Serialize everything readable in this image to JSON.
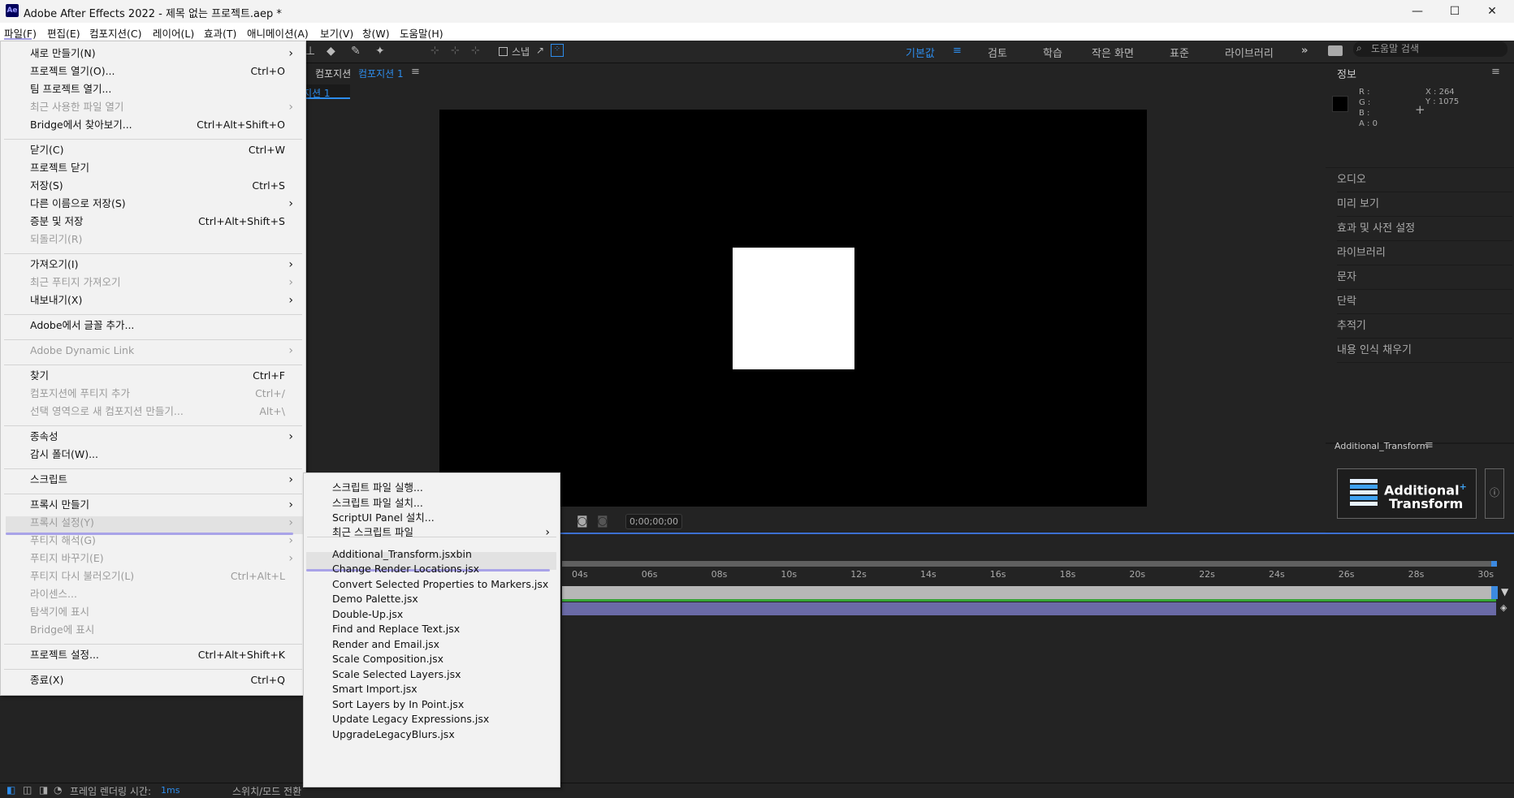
{
  "window": {
    "title": "Adobe After Effects 2022 - 제목 없는 프로젝트.aep *",
    "logo": "Ae",
    "minimize": "—",
    "maximize": "☐",
    "close": "✕"
  },
  "menubar": [
    "파일(F)",
    "편집(E)",
    "컴포지션(C)",
    "레이어(L)",
    "효과(T)",
    "애니메이션(A)",
    "보기(V)",
    "창(W)",
    "도움말(H)"
  ],
  "toolbar": {
    "snap_label": "스냅",
    "workspaces": [
      "기본값",
      "검토",
      "학습",
      "작은 화면",
      "표준",
      "라이브러리"
    ],
    "search_placeholder": "도움말 검색"
  },
  "composition": {
    "tab_prefix": "컴포지션",
    "tab_name": "컴포지션 1",
    "sub_tab": "지션 1",
    "timecode": "0;00;00;00",
    "accent": "#2d8ceb"
  },
  "info_panel": {
    "title": "정보",
    "r": "R :",
    "g": "G :",
    "b": "B :",
    "a": "A :  0",
    "x": "X : 264",
    "y": "Y : 1075"
  },
  "right_panels": [
    "오디오",
    "미리 보기",
    "효과 및 사전 설정",
    "라이브러리",
    "문자",
    "단락",
    "추적기",
    "내용 인식 채우기"
  ],
  "additional_transform": {
    "panel_title": "Additional_Transform",
    "line1": "Additional",
    "line2": "Transform",
    "plus": "+"
  },
  "timeline": {
    "ticks": [
      "04s",
      "06s",
      "08s",
      "10s",
      "12s",
      "14s",
      "16s",
      "18s",
      "20s",
      "22s",
      "24s",
      "26s",
      "28s",
      "30s"
    ]
  },
  "statusbar": {
    "render_label": "프레임 렌더링 시간:",
    "render_value": "1ms",
    "switch_label": "스위치/모드 전환"
  },
  "file_menu": [
    {
      "label": "새로 만들기(N)",
      "shortcut": "",
      "submenu": true,
      "disabled": false
    },
    {
      "label": "프로젝트 열기(O)...",
      "shortcut": "Ctrl+O",
      "submenu": false,
      "disabled": false
    },
    {
      "label": "팀 프로젝트 열기...",
      "shortcut": "",
      "submenu": false,
      "disabled": false
    },
    {
      "label": "최근 사용한 파일 열기",
      "shortcut": "",
      "submenu": true,
      "disabled": true
    },
    {
      "label": "Bridge에서 찾아보기...",
      "shortcut": "Ctrl+Alt+Shift+O",
      "submenu": false,
      "disabled": false
    },
    {
      "label": "닫기(C)",
      "shortcut": "Ctrl+W",
      "submenu": false,
      "disabled": false
    },
    {
      "label": "프로젝트 닫기",
      "shortcut": "",
      "submenu": false,
      "disabled": false
    },
    {
      "label": "저장(S)",
      "shortcut": "Ctrl+S",
      "submenu": false,
      "disabled": false
    },
    {
      "label": "다른 이름으로 저장(S)",
      "shortcut": "",
      "submenu": true,
      "disabled": false
    },
    {
      "label": "증분 및 저장",
      "shortcut": "Ctrl+Alt+Shift+S",
      "submenu": false,
      "disabled": false
    },
    {
      "label": "되돌리기(R)",
      "shortcut": "",
      "submenu": false,
      "disabled": true
    },
    {
      "label": "가져오기(I)",
      "shortcut": "",
      "submenu": true,
      "disabled": false
    },
    {
      "label": "최근 푸티지 가져오기",
      "shortcut": "",
      "submenu": true,
      "disabled": true
    },
    {
      "label": "내보내기(X)",
      "shortcut": "",
      "submenu": true,
      "disabled": false
    },
    {
      "label": "Adobe에서 글꼴 추가...",
      "shortcut": "",
      "submenu": false,
      "disabled": false
    },
    {
      "label": "Adobe Dynamic Link",
      "shortcut": "",
      "submenu": true,
      "disabled": true
    },
    {
      "label": "찾기",
      "shortcut": "Ctrl+F",
      "submenu": false,
      "disabled": false
    },
    {
      "label": "컴포지션에 푸티지 추가",
      "shortcut": "Ctrl+/",
      "submenu": false,
      "disabled": true
    },
    {
      "label": "선택 영역으로 새 컴포지션 만들기...",
      "shortcut": "Alt+\\",
      "submenu": false,
      "disabled": true
    },
    {
      "label": "종속성",
      "shortcut": "",
      "submenu": true,
      "disabled": false
    },
    {
      "label": "감시 폴더(W)...",
      "shortcut": "",
      "submenu": false,
      "disabled": false
    },
    {
      "label": "스크립트",
      "shortcut": "",
      "submenu": true,
      "disabled": false
    },
    {
      "label": "프록시 만들기",
      "shortcut": "",
      "submenu": true,
      "disabled": false
    },
    {
      "label": "프록시 설정(Y)",
      "shortcut": "",
      "submenu": true,
      "disabled": true
    },
    {
      "label": "푸티지 해석(G)",
      "shortcut": "",
      "submenu": true,
      "disabled": true
    },
    {
      "label": "푸티지 바꾸기(E)",
      "shortcut": "",
      "submenu": true,
      "disabled": true
    },
    {
      "label": "푸티지 다시 불러오기(L)",
      "shortcut": "Ctrl+Alt+L",
      "submenu": false,
      "disabled": true
    },
    {
      "label": "라이센스...",
      "shortcut": "",
      "submenu": false,
      "disabled": true
    },
    {
      "label": "탐색기에 표시",
      "shortcut": "",
      "submenu": false,
      "disabled": true
    },
    {
      "label": "Bridge에 표시",
      "shortcut": "",
      "submenu": false,
      "disabled": true
    },
    {
      "label": "프로젝트 설정...",
      "shortcut": "Ctrl+Alt+Shift+K",
      "submenu": false,
      "disabled": false
    },
    {
      "label": "종료(X)",
      "shortcut": "Ctrl+Q",
      "submenu": false,
      "disabled": false
    }
  ],
  "script_menu": [
    {
      "label": "스크립트 파일 실행...",
      "submenu": false
    },
    {
      "label": "스크립트 파일 설치...",
      "submenu": false
    },
    {
      "label": "ScriptUI Panel 설치...",
      "submenu": false
    },
    {
      "label": "최근 스크립트 파일",
      "submenu": true
    },
    {
      "label": "Additional_Transform.jsxbin",
      "submenu": false
    },
    {
      "label": "Change Render Locations.jsx",
      "submenu": false
    },
    {
      "label": "Convert Selected Properties to Markers.jsx",
      "submenu": false
    },
    {
      "label": "Demo Palette.jsx",
      "submenu": false
    },
    {
      "label": "Double-Up.jsx",
      "submenu": false
    },
    {
      "label": "Find and Replace Text.jsx",
      "submenu": false
    },
    {
      "label": "Render and Email.jsx",
      "submenu": false
    },
    {
      "label": "Scale Composition.jsx",
      "submenu": false
    },
    {
      "label": "Scale Selected Layers.jsx",
      "submenu": false
    },
    {
      "label": "Smart Import.jsx",
      "submenu": false
    },
    {
      "label": "Sort Layers by In Point.jsx",
      "submenu": false
    },
    {
      "label": "Update Legacy Expressions.jsx",
      "submenu": false
    },
    {
      "label": "UpgradeLegacyBlurs.jsx",
      "submenu": false
    }
  ]
}
